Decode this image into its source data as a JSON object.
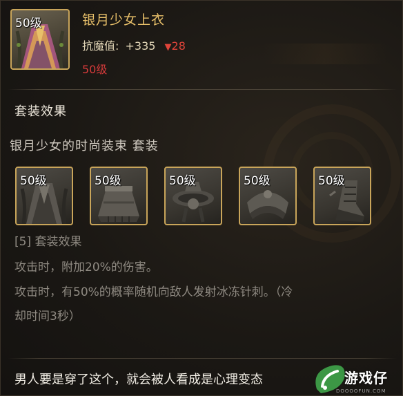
{
  "item": {
    "level_badge": "50级",
    "name": "银月少女上衣",
    "stat_label": "抗魔值:",
    "stat_value": "+335",
    "stat_down_arrow": "▼",
    "stat_down_value": "28",
    "required_level": "50级",
    "icon": "robe-chestpiece-icon"
  },
  "set": {
    "section_title": "套装效果",
    "set_name": "银月少女的时尚装束 套装",
    "pieces": [
      {
        "level_badge": "50级",
        "icon": "robe-chestpiece-icon"
      },
      {
        "level_badge": "50级",
        "icon": "skirt-icon"
      },
      {
        "level_badge": "50级",
        "icon": "belt-icon"
      },
      {
        "level_badge": "50级",
        "icon": "shoulder-icon"
      },
      {
        "level_badge": "50级",
        "icon": "boots-icon"
      }
    ],
    "bonus_header": "[5] 套装效果",
    "bonus_lines": [
      "攻击时，附加20%的伤害。",
      "攻击时，有50%的概率随机向敌人发射冰冻针刺。（冷",
      "却时间3秒）"
    ]
  },
  "quote": "男人要是穿了这个，就会被人看成是心理变态",
  "watermark": {
    "text": "游戏仔",
    "sub": "DOOOOFUN.COM"
  },
  "colors": {
    "gold_border": "#c9a55a",
    "item_name": "#e8c06a",
    "red": "#e0443a",
    "muted_text": "#8f8a82"
  }
}
